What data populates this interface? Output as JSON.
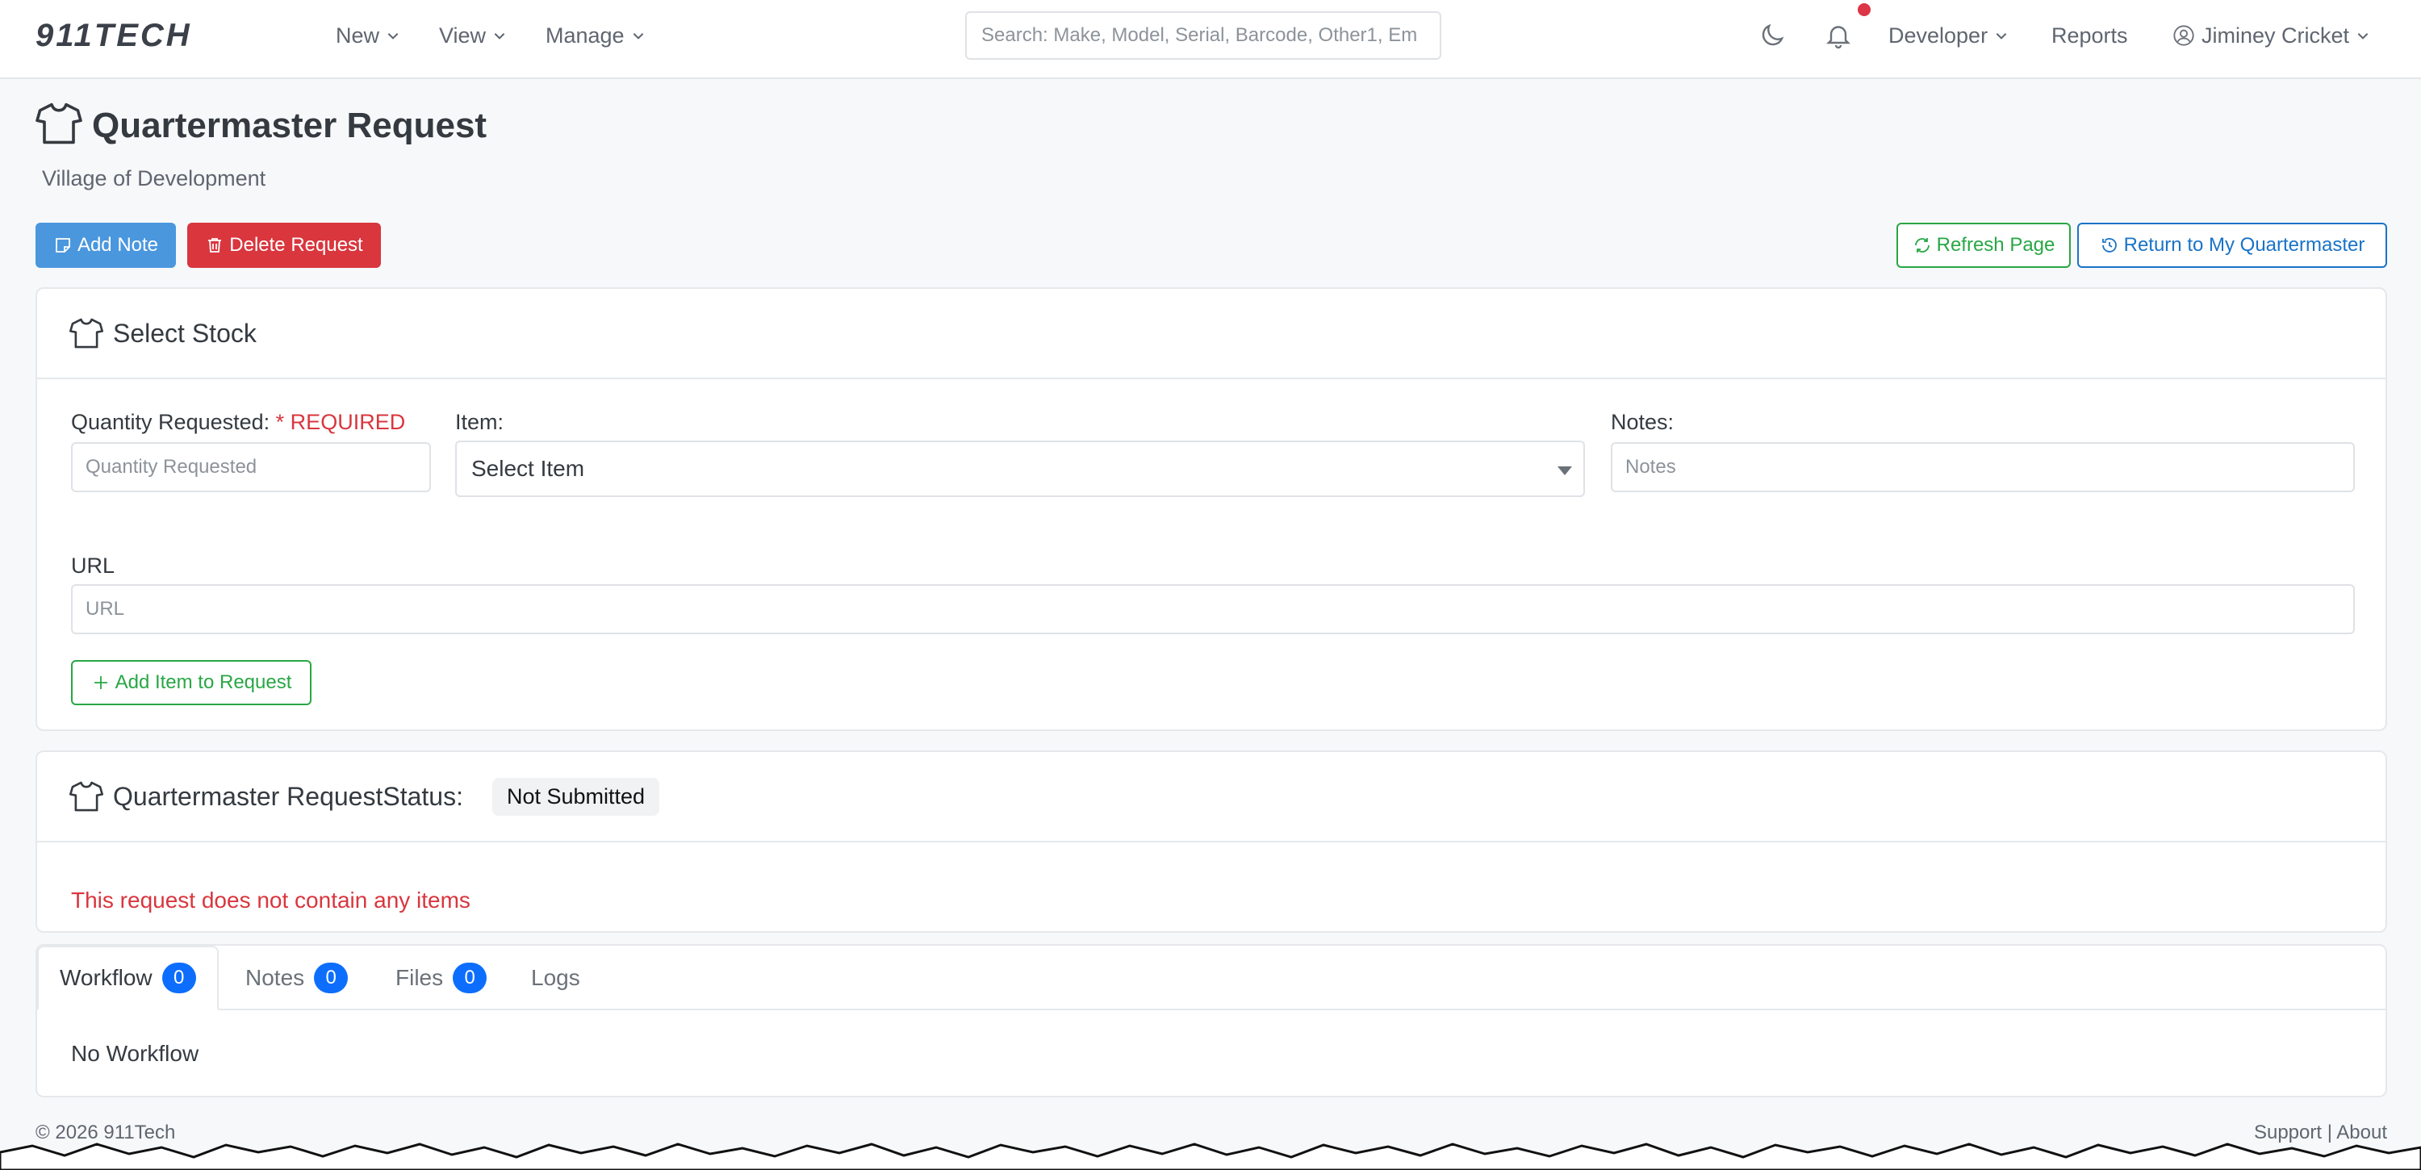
{
  "navbar": {
    "brand": "911TECH",
    "menu": [
      {
        "label": "New"
      },
      {
        "label": "View"
      },
      {
        "label": "Manage"
      }
    ],
    "search_placeholder": "Search: Make, Model, Serial, Barcode, Other1, Em",
    "right": {
      "developer": "Developer",
      "reports": "Reports",
      "user": "Jiminey Cricket"
    }
  },
  "header": {
    "title": "Quartermaster Request",
    "subtitle": "Village of Development",
    "buttons": {
      "add_note": "Add Note",
      "delete_request": "Delete Request",
      "refresh_page": "Refresh Page",
      "return": "Return to My Quartermaster"
    }
  },
  "select_stock": {
    "title": "Select Stock",
    "quantity_label": "Quantity Requested:",
    "required": "* REQUIRED",
    "quantity_placeholder": "Quantity Requested",
    "item_label": "Item:",
    "item_value": "Select Item",
    "notes_label": "Notes:",
    "notes_placeholder": "Notes",
    "url_label": "URL",
    "url_placeholder": "URL",
    "add_item_button": "Add Item to Request"
  },
  "status_card": {
    "title": "Quartermaster RequestStatus:",
    "status": "Not Submitted",
    "empty_message": "This request does not contain any items"
  },
  "tabs": {
    "items": [
      {
        "label": "Workflow",
        "count": "0"
      },
      {
        "label": "Notes",
        "count": "0"
      },
      {
        "label": "Files",
        "count": "0"
      },
      {
        "label": "Logs"
      }
    ],
    "active_content": "No Workflow"
  },
  "footer": {
    "copyright": "© 2026 911Tech",
    "support": "Support",
    "separator": "|",
    "about": "About"
  },
  "colors": {
    "primary": "#4a97de",
    "danger": "#d9363e",
    "success": "#28a745",
    "badge": "#0d6efd"
  }
}
